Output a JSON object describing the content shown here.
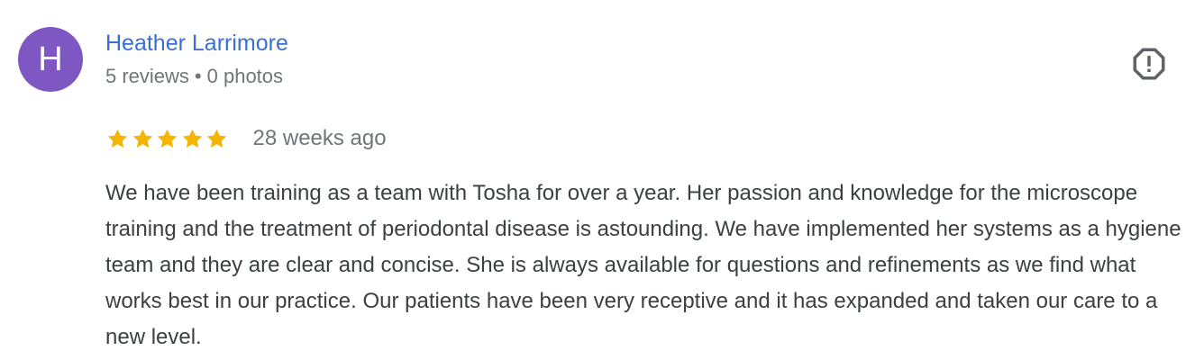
{
  "review": {
    "avatar_letter": "H",
    "author_name": "Heather Larrimore",
    "reviews_count": "5 reviews",
    "separator": "•",
    "photos_count": "0 photos",
    "rating": 5,
    "rating_max": 5,
    "date": "28 weeks ago",
    "text": "We have been training as a team with Tosha for over a year. Her passion and knowledge for the microscope training and the treatment of periodontal disease is astounding. We have implemented her systems as a hygiene team and they are clear and concise. She is always available for questions and refinements as we find what works best in our practice. Our patients have been very receptive and it has expanded and taken our care to a new level."
  },
  "colors": {
    "avatar_bg": "#7e57c2",
    "author_link": "#3b6fd0",
    "star": "#f4b400",
    "meta_text": "#70757a",
    "body_text": "#3c4043",
    "flag_icon": "#5f6368"
  },
  "icons": {
    "report": "report-flag-icon",
    "star": "star-icon"
  }
}
